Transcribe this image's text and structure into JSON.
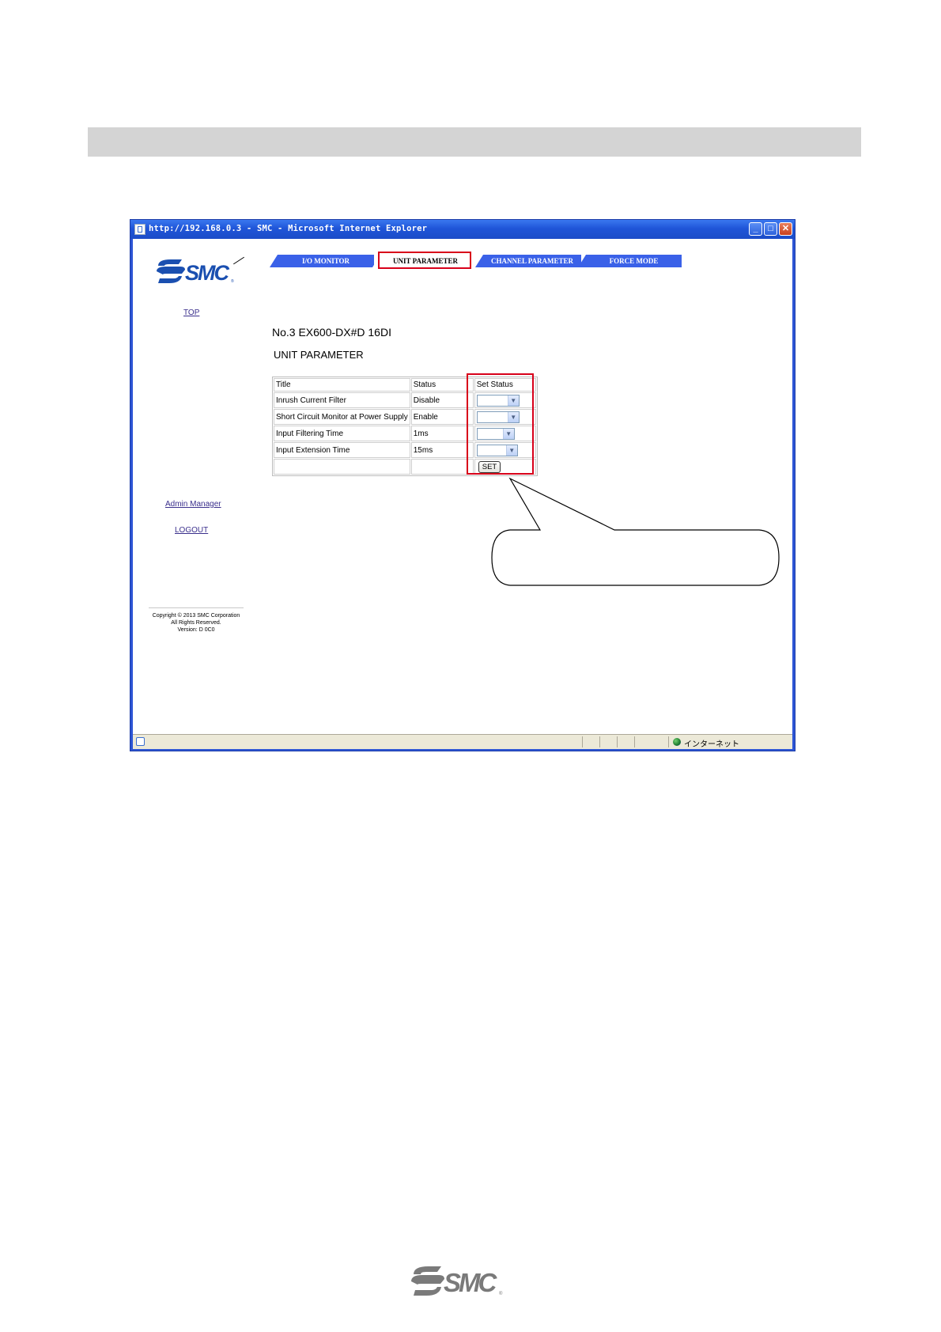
{
  "browser": {
    "title": "http://192.168.0.3 - SMC - Microsoft Internet Explorer",
    "buttons": {
      "minimize": "_",
      "maximize": "□",
      "close": "✕"
    },
    "status_zone": "インターネット"
  },
  "sidebar": {
    "top_link": "TOP",
    "admin_link": "Admin Manager",
    "logout_link": "LOGOUT",
    "copyright": [
      "Copyright © 2013 SMC Corporation",
      "All Rights Reserved.",
      "Version: D 0C0"
    ]
  },
  "tabs": [
    "I/O MONITOR",
    "UNIT PARAMETER",
    "CHANNEL PARAMETER",
    "FORCE MODE"
  ],
  "main": {
    "heading": "No.3 EX600-DX#D 16DI",
    "subheading": "UNIT PARAMETER"
  },
  "table": {
    "headers": [
      "Title",
      "Status",
      "Set Status"
    ],
    "rows": [
      {
        "title": "Inrush Current Filter",
        "status": "Disable"
      },
      {
        "title": "Short Circuit Monitor at Power Supply",
        "status": "Enable"
      },
      {
        "title": "Input Filtering Time",
        "status": "1ms"
      },
      {
        "title": "Input Extension Time",
        "status": "15ms"
      }
    ],
    "set_button": "SET"
  },
  "colors": {
    "highlight": "#d8001a",
    "tab_blue": "#3a61e8",
    "brand_blue": "#1a4fb0",
    "section_bar": "#d4d4d4"
  },
  "icons": [
    "smc-logo",
    "ie-page-icon",
    "globe-icon",
    "chevron-down-icon"
  ]
}
